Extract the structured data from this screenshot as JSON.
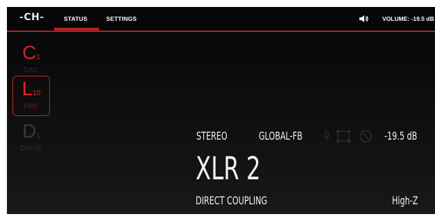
{
  "header": {
    "logo_text": "CH",
    "tabs": [
      {
        "label": "STATUS",
        "active": true
      },
      {
        "label": "SETTINGS",
        "active": false
      }
    ],
    "speaker_icon": "speaker-icon",
    "volume_text": "VOLUME: -19.5 dB"
  },
  "sidebar": {
    "modes": [
      {
        "letter": "C",
        "sub": "1",
        "label": "DAC",
        "selected": false
      },
      {
        "letter": "L",
        "sub": "10",
        "label": "PRE",
        "selected": true
      },
      {
        "letter": "D",
        "sub": "1",
        "label": "DRIVE",
        "selected": false
      }
    ]
  },
  "status": {
    "channel_mode": "STEREO",
    "feedback": "GLOBAL-FB",
    "level": "-19.5 dB",
    "input_name": "XLR 2",
    "coupling": "DIRECT COUPLING",
    "impedance": "High-Z",
    "icons": [
      "mic-icon",
      "frame-icon",
      "clock-icon"
    ]
  },
  "colors": {
    "accent": "#b32126",
    "background": "#0b0b0b",
    "text": "#f2f2f2"
  }
}
